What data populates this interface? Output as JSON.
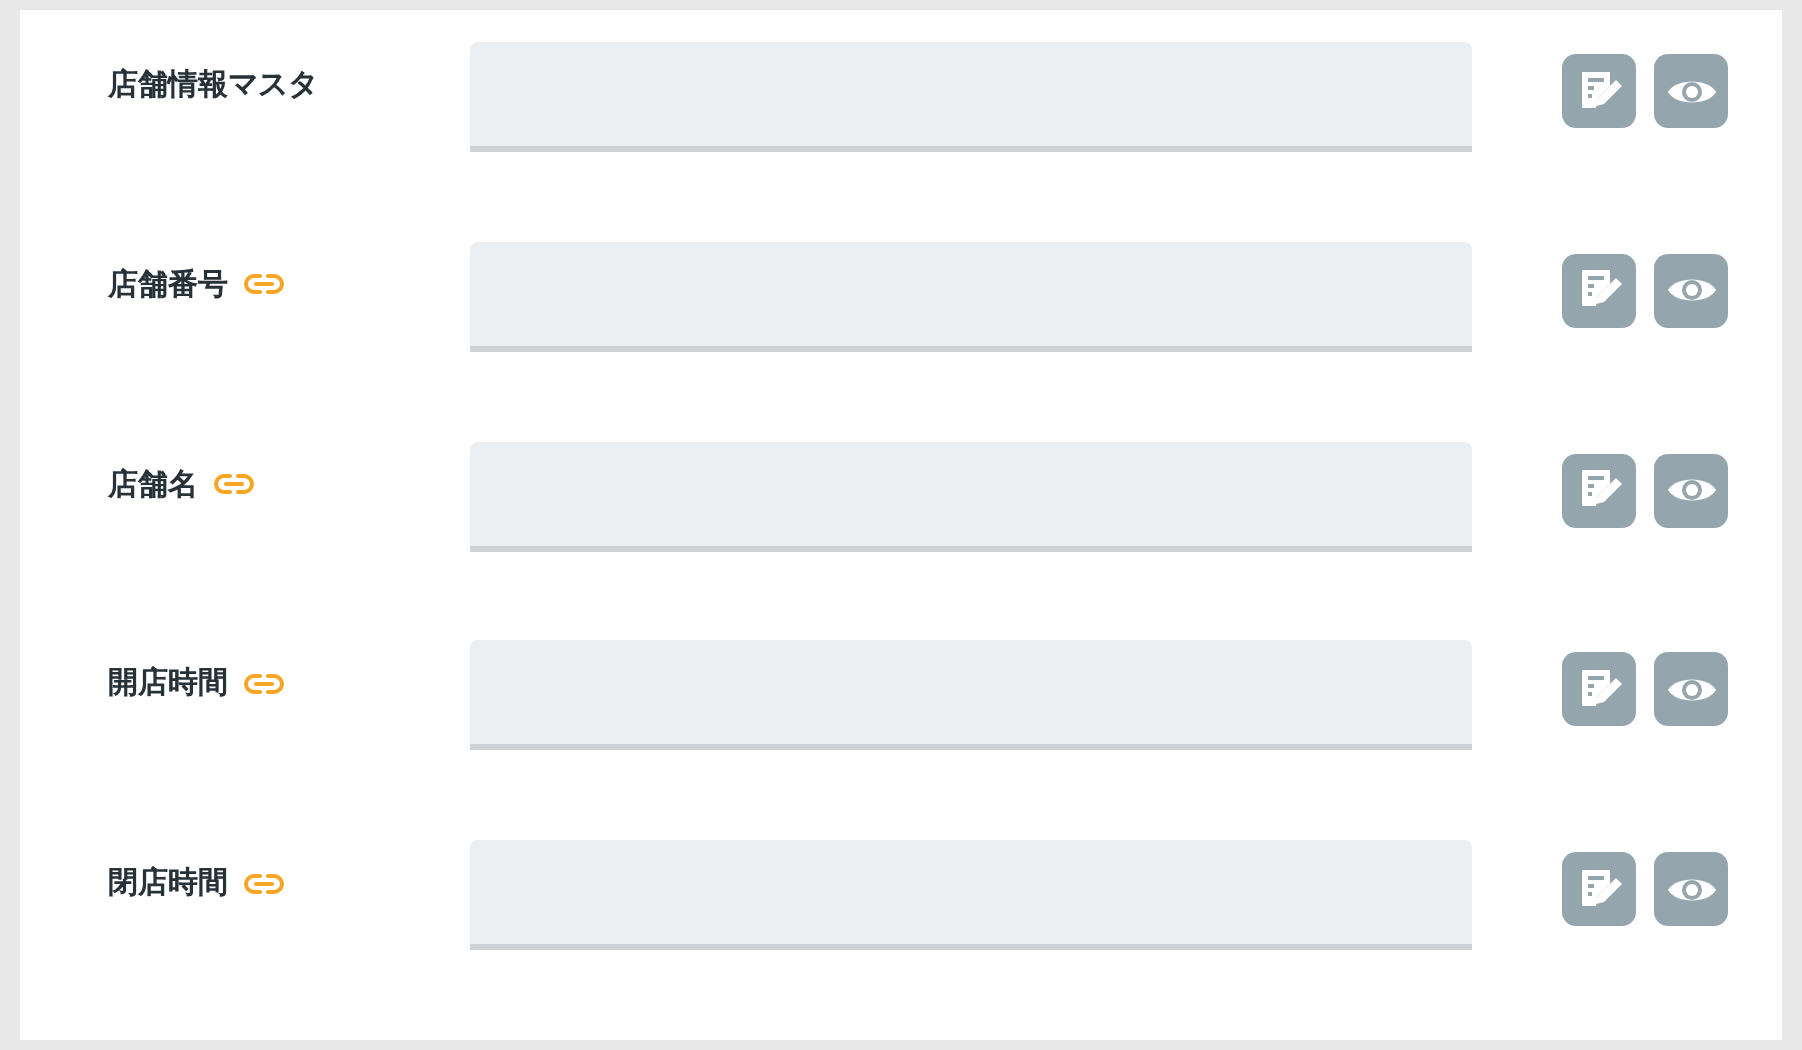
{
  "rows": [
    {
      "label": "店舗情報マスタ",
      "linked": false
    },
    {
      "label": "店舗番号",
      "linked": true
    },
    {
      "label": "店舗名",
      "linked": true
    },
    {
      "label": "開店時間",
      "linked": true
    },
    {
      "label": "閉店時間",
      "linked": true
    }
  ]
}
